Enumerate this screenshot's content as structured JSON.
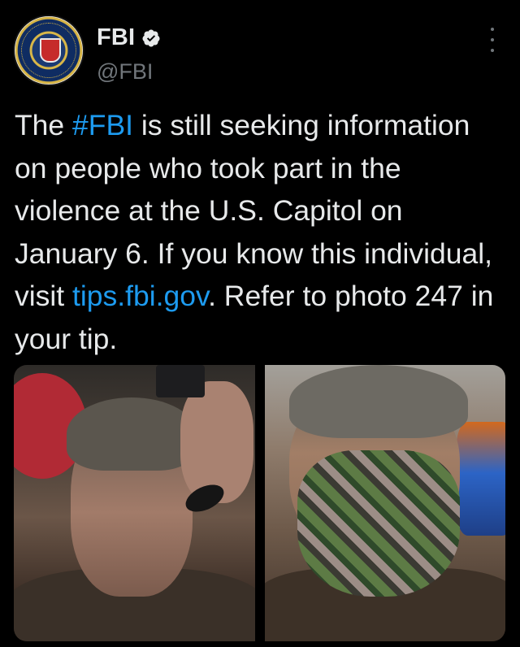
{
  "account": {
    "name": "FBI",
    "handle": "@FBI",
    "verified": true,
    "avatar_icon": "fbi-seal-icon"
  },
  "tweet": {
    "text_before_hashtag": "The ",
    "hashtag": "#FBI",
    "text_after_hashtag": " is still seeking information on people who took part in the violence at the U.S. Capitol on January 6. If you know this individual, visit ",
    "link": "tips.fbi.gov",
    "text_after_link": ". Refer to photo 247 in your tip."
  },
  "media": {
    "photo_count": 2
  },
  "colors": {
    "background": "#000000",
    "text": "#e7e9ea",
    "secondary": "#71767b",
    "link": "#1d9bf0"
  }
}
